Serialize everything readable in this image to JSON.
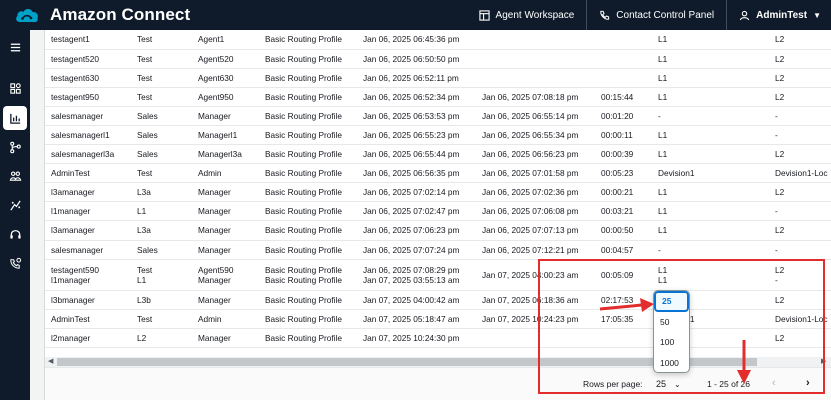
{
  "app": {
    "title": "Amazon Connect"
  },
  "header": {
    "agent_workspace": "Agent Workspace",
    "contact_control_panel": "Contact Control Panel",
    "user": "AdminTest"
  },
  "sidebar": {
    "items": [
      "menu-icon",
      "dashboard-icon",
      "analytics-icon",
      "routing-icon",
      "users-icon",
      "channels-icon",
      "agent-headset-icon",
      "integrations-icon"
    ]
  },
  "table": {
    "rows": [
      [
        "testagent1",
        "Test",
        "Agent1",
        "Basic Routing Profile",
        "Jan 06, 2025 06:45:36 pm",
        "",
        "",
        "L1",
        "L2"
      ],
      [
        "testagent520",
        "Test",
        "Agent520",
        "Basic Routing Profile",
        "Jan 06, 2025 06:50:50 pm",
        "",
        "",
        "L1",
        "L2"
      ],
      [
        "testagent630",
        "Test",
        "Agent630",
        "Basic Routing Profile",
        "Jan 06, 2025 06:52:11 pm",
        "",
        "",
        "L1",
        "L2"
      ],
      [
        "testagent950",
        "Test",
        "Agent950",
        "Basic Routing Profile",
        "Jan 06, 2025 06:52:34 pm",
        "Jan 06, 2025 07:08:18 pm",
        "00:15:44",
        "L1",
        "L2"
      ],
      [
        "salesmanager",
        "Sales",
        "Manager",
        "Basic Routing Profile",
        "Jan 06, 2025 06:53:53 pm",
        "Jan 06, 2025 06:55:14 pm",
        "00:01:20",
        "-",
        "-"
      ],
      [
        "salesmanagerl1",
        "Sales",
        "Managerl1",
        "Basic Routing Profile",
        "Jan 06, 2025 06:55:23 pm",
        "Jan 06, 2025 06:55:34 pm",
        "00:00:11",
        "L1",
        "-"
      ],
      [
        "salesmanagerl3a",
        "Sales",
        "Managerl3a",
        "Basic Routing Profile",
        "Jan 06, 2025 06:55:44 pm",
        "Jan 06, 2025 06:56:23 pm",
        "00:00:39",
        "L1",
        "L2"
      ],
      [
        "AdminTest",
        "Test",
        "Admin",
        "Basic Routing Profile",
        "Jan 06, 2025 06:56:35 pm",
        "Jan 06, 2025 07:01:58 pm",
        "00:05:23",
        "Devision1",
        "Devision1-Loc"
      ],
      [
        "l3amanager",
        "L3a",
        "Manager",
        "Basic Routing Profile",
        "Jan 06, 2025 07:02:14 pm",
        "Jan 06, 2025 07:02:36 pm",
        "00:00:21",
        "L1",
        "L2"
      ],
      [
        "l1manager",
        "L1",
        "Manager",
        "Basic Routing Profile",
        "Jan 06, 2025 07:02:47 pm",
        "Jan 06, 2025 07:06:08 pm",
        "00:03:21",
        "L1",
        "-"
      ],
      [
        "l3amanager",
        "L3a",
        "Manager",
        "Basic Routing Profile",
        "Jan 06, 2025 07:06:23 pm",
        "Jan 06, 2025 07:07:13 pm",
        "00:00:50",
        "L1",
        "L2"
      ],
      [
        "salesmanager",
        "Sales",
        "Manager",
        "Basic Routing Profile",
        "Jan 06, 2025 07:07:24 pm",
        "Jan 06, 2025 07:12:21 pm",
        "00:04:57",
        "-",
        "-"
      ]
    ],
    "overlap_row": {
      "line1": [
        "testagent590",
        "Test",
        "Agent590",
        "Basic Routing Profile",
        "Jan 06, 2025 07:08:29 pm",
        "",
        "",
        "L1",
        "L2"
      ],
      "line2": [
        "l1manager",
        "L1",
        "Manager",
        "Basic Routing Profile",
        "Jan 07, 2025 03:55:13 am",
        "Jan 07, 2025 04:00:23 am",
        "00:05:09",
        "L1",
        "-"
      ]
    },
    "rows_after": [
      [
        "l3bmanager",
        "L3b",
        "Manager",
        "Basic Routing Profile",
        "Jan 07, 2025 04:00:42 am",
        "Jan 07, 2025 06:18:36 am",
        "02:17:53",
        "",
        "L2"
      ],
      [
        "AdminTest",
        "Test",
        "Admin",
        "Basic Routing Profile",
        "Jan 07, 2025 05:18:47 am",
        "Jan 07, 2025 10:24:23 pm",
        "17:05:35",
        "Devision1",
        "Devision1-Loc"
      ],
      [
        "l2manager",
        "L2",
        "Manager",
        "Basic Routing Profile",
        "Jan 07, 2025 10:24:30 pm",
        "",
        "",
        "",
        "L2"
      ]
    ]
  },
  "pagination": {
    "rows_per_page_label": "Rows per page:",
    "selected": "25",
    "options": [
      "25",
      "50",
      "100",
      "1000"
    ],
    "range": "1 - 25 of 26"
  },
  "colors": {
    "topbar": "#0f1b2a",
    "accent": "#0972d3",
    "annotation": "#e32c2c"
  }
}
